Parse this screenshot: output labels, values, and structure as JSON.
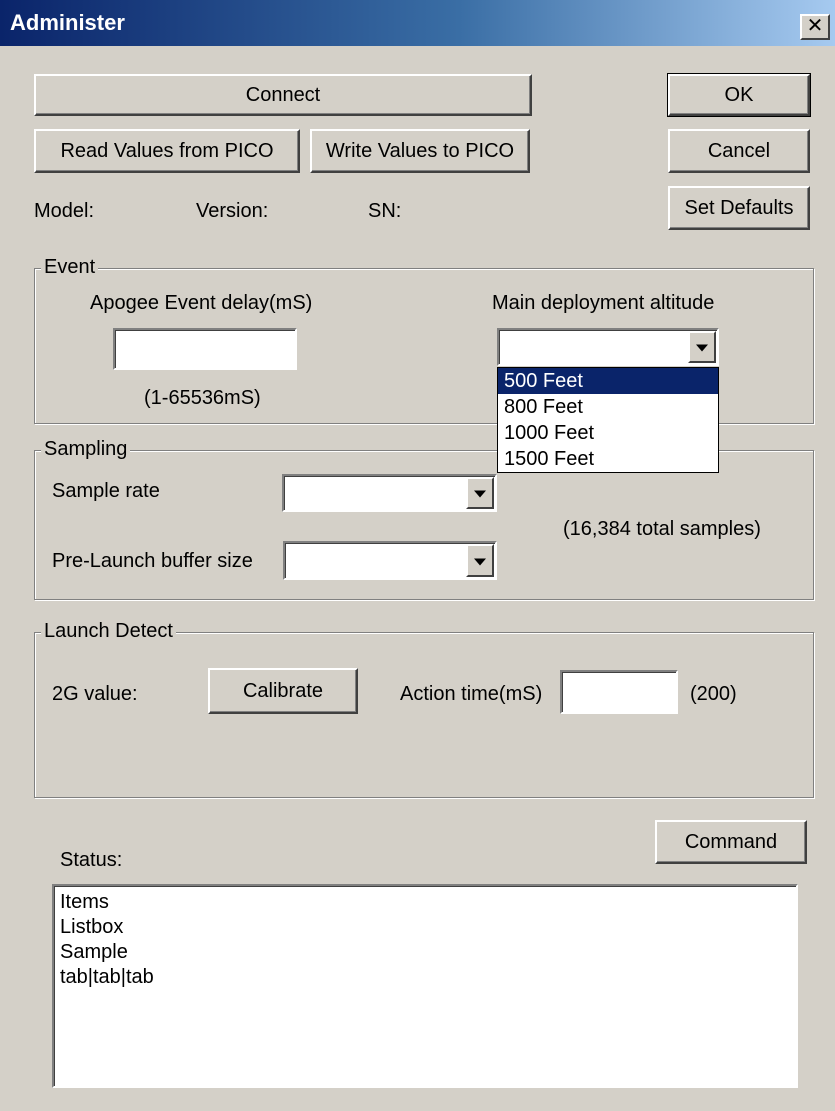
{
  "window": {
    "title": "Administer",
    "close": "✕"
  },
  "buttons": {
    "connect": "Connect",
    "read": "Read Values from PICO",
    "write": "Write Values to PICO",
    "ok": "OK",
    "cancel": "Cancel",
    "set_defaults": "Set Defaults",
    "calibrate": "Calibrate",
    "command": "Command"
  },
  "info": {
    "model": "Model:",
    "version": "Version:",
    "sn": "SN:"
  },
  "event": {
    "title": "Event",
    "apogee_label": "Apogee Event delay(mS)",
    "apogee_value": "",
    "apogee_hint": "(1-65536mS)",
    "main_label": "Main deployment altitude",
    "main_value": "",
    "main_options": [
      "500 Feet",
      "800 Feet",
      "1000 Feet",
      "1500 Feet"
    ],
    "main_selected_option": "500 Feet"
  },
  "sampling": {
    "title": "Sampling",
    "rate_label": "Sample rate",
    "rate_value": "",
    "buffer_label": "Pre-Launch buffer size",
    "buffer_value": "",
    "total_note": "(16,384 total samples)"
  },
  "launch": {
    "title": "Launch Detect",
    "g_label": "2G value:",
    "action_label": "Action time(mS)",
    "action_value": "",
    "action_default": "(200)"
  },
  "status": {
    "label": "Status:",
    "items": [
      "Items",
      "Listbox",
      "Sample",
      "tab|tab|tab"
    ]
  },
  "colors": {
    "face": "#d4d0c8",
    "title_start": "#0a246a",
    "title_end": "#a6caf0",
    "selection": "#0a246a"
  }
}
